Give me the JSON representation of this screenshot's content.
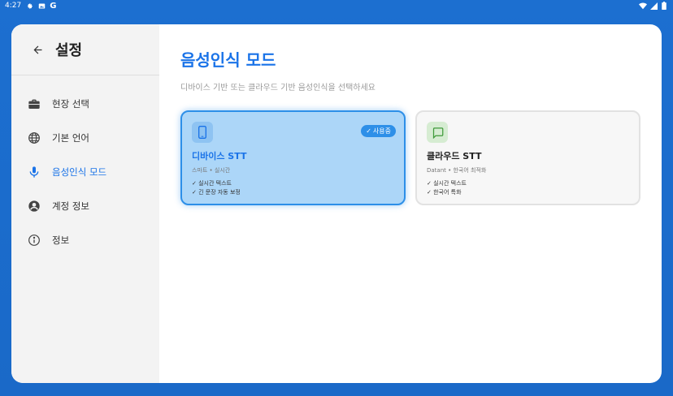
{
  "status_bar": {
    "time": "4:27",
    "g_label": "G"
  },
  "sidebar": {
    "title": "설정",
    "items": [
      {
        "label": "현장 선택",
        "icon": "briefcase-icon"
      },
      {
        "label": "기본 언어",
        "icon": "globe-icon"
      },
      {
        "label": "음성인식 모드",
        "icon": "microphone-icon",
        "active": true
      },
      {
        "label": "계정 정보",
        "icon": "account-icon"
      },
      {
        "label": "정보",
        "icon": "info-icon"
      }
    ]
  },
  "main": {
    "title": "음성인식 모드",
    "subtitle": "디바이스 기반 또는 클라우드 기반 음성인식을 선택하세요",
    "options": [
      {
        "title": "디바이스 STT",
        "subtitle": "스마트 • 실시간",
        "badge": "사용중",
        "features": [
          "실시간 텍스트",
          "긴 문장 자동 보정"
        ],
        "icon": "phone-icon"
      },
      {
        "title": "클라우드 STT",
        "subtitle": "Datant • 한국어 최적화",
        "features": [
          "실시간 텍스트",
          "한국어 특화"
        ],
        "icon": "chat-icon"
      }
    ]
  },
  "colors": {
    "accent": "#1a73e8",
    "background": "#1c6fd0",
    "selected_card": "#acd6f8"
  }
}
